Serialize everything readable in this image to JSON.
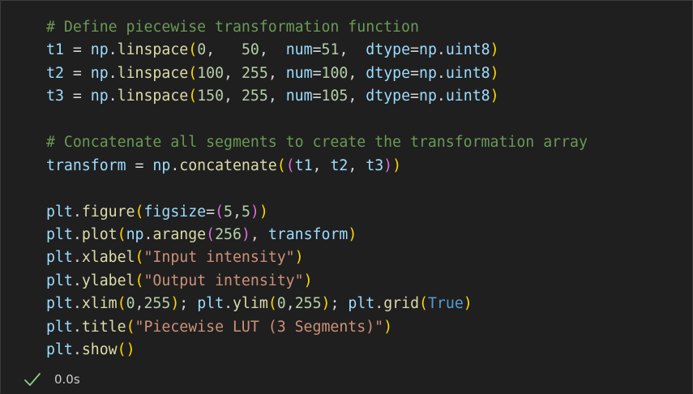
{
  "code_lines": [
    "# Define piecewise transformation function",
    "t1 = np.linspace(0,   50,  num=51,  dtype=np.uint8)",
    "t2 = np.linspace(100, 255, num=100, dtype=np.uint8)",
    "t3 = np.linspace(150, 255, num=105, dtype=np.uint8)",
    "",
    "# Concatenate all segments to create the transformation array",
    "transform = np.concatenate((t1, t2, t3))",
    "",
    "plt.figure(figsize=(5,5))",
    "plt.plot(np.arange(256), transform)",
    "plt.xlabel(\"Input intensity\")",
    "plt.ylabel(\"Output intensity\")",
    "plt.xlim(0,255); plt.ylim(0,255); plt.grid(True)",
    "plt.title(\"Piecewise LUT (3 Segments)\")",
    "plt.show()"
  ],
  "status": {
    "icon": "check-icon",
    "duration": "0.0s",
    "success_color": "#89d185"
  },
  "theme": {
    "background": "#1f1f1f",
    "comment": "#6a9955",
    "variable": "#9cdcfe",
    "function": "#dcdcaa",
    "number": "#b5cea8",
    "string": "#ce9178",
    "keyword": "#569cd6",
    "bracket_1": "#ffd700",
    "bracket_2": "#da70d6",
    "bracket_3": "#179fff"
  }
}
